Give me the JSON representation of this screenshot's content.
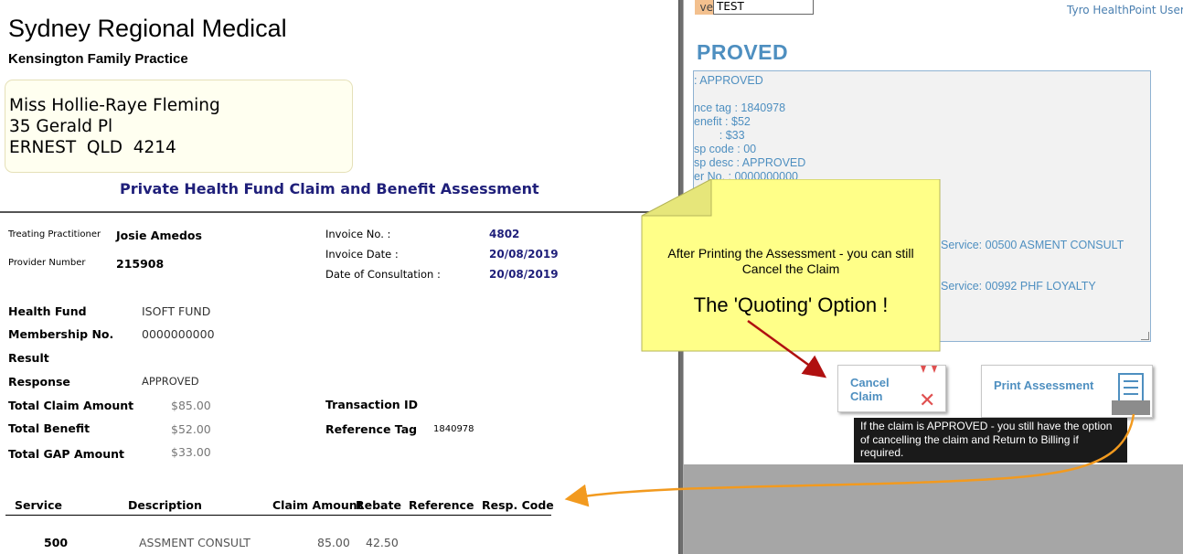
{
  "left_doc": {
    "org_name": "Sydney Regional Medical",
    "practice_name": "Kensington Family Practice",
    "address": [
      "Miss Hollie-Raye Fleming",
      "35 Gerald Pl",
      "ERNEST  QLD  4214"
    ],
    "title": "Private Health Fund Claim and Benefit Assessment",
    "practitioner_label": "Treating Practitioner",
    "practitioner_value": "Josie Amedos",
    "provider_label": "Provider Number",
    "provider_value": "215908",
    "invoice_no_label": "Invoice No. :",
    "invoice_no_value": "4802",
    "invoice_date_label": "Invoice Date :",
    "invoice_date_value": "20/08/2019",
    "consult_date_label": "Date of Consultation :",
    "consult_date_value": "20/08/2019",
    "health_fund_label": "Health Fund",
    "health_fund_value": "ISOFT FUND",
    "membership_label": "Membership No.",
    "membership_value": "0000000000",
    "result_label": "Result",
    "response_label": "Response",
    "response_value": "APPROVED",
    "total_claim_label": "Total Claim Amount",
    "total_claim_value": "$85.00",
    "total_benefit_label": "Total Benefit",
    "total_benefit_value": "$52.00",
    "total_gap_label": "Total GAP Amount",
    "total_gap_value": "$33.00",
    "transaction_label": "Transaction ID",
    "reference_tag_label": "Reference Tag",
    "reference_tag_value": "1840978",
    "table": {
      "headers": [
        "Service",
        "Description",
        "Claim Amount",
        "Rebate",
        "Reference",
        "Resp. Code"
      ],
      "rows": [
        {
          "service": "500",
          "description": "ASSMENT CONSULT",
          "claim_amount": "85.00",
          "rebate": "42.50"
        }
      ]
    }
  },
  "right_app": {
    "field_label_fragment": "ve",
    "field_value": "TEST",
    "user_link": "Tyro HealthPoint User",
    "status_heading": "PROVED",
    "response_lines": [
      ": APPROVED",
      "nce tag  :  1840978",
      "enefit  : $52",
      "        : $33",
      "sp code  :  00",
      "sp desc  :  APPROVED",
      "er No.     :  0000000000",
      "Service: 00500 ASMENT CONSULT",
      "Service: 00992 PHF LOYALTY"
    ],
    "cancel_button_label": "Cancel Claim",
    "print_button_label": "Print Assessment",
    "tooltip": "If the claim is APPROVED - you still have the option of cancelling the claim and Return to Billing if required."
  },
  "callout": {
    "text": "After Printing the Assessment - you can still Cancel the Claim",
    "emphasis": "The 'Quoting' Option !"
  },
  "colors": {
    "accent_blue": "#4e8fc0",
    "doc_navy": "#1f1f7a",
    "note_yellow": "#ffff88",
    "arrow_red": "#b01010",
    "arrow_orange": "#f29a1f",
    "tooltip_bg": "#1a1a1a"
  }
}
